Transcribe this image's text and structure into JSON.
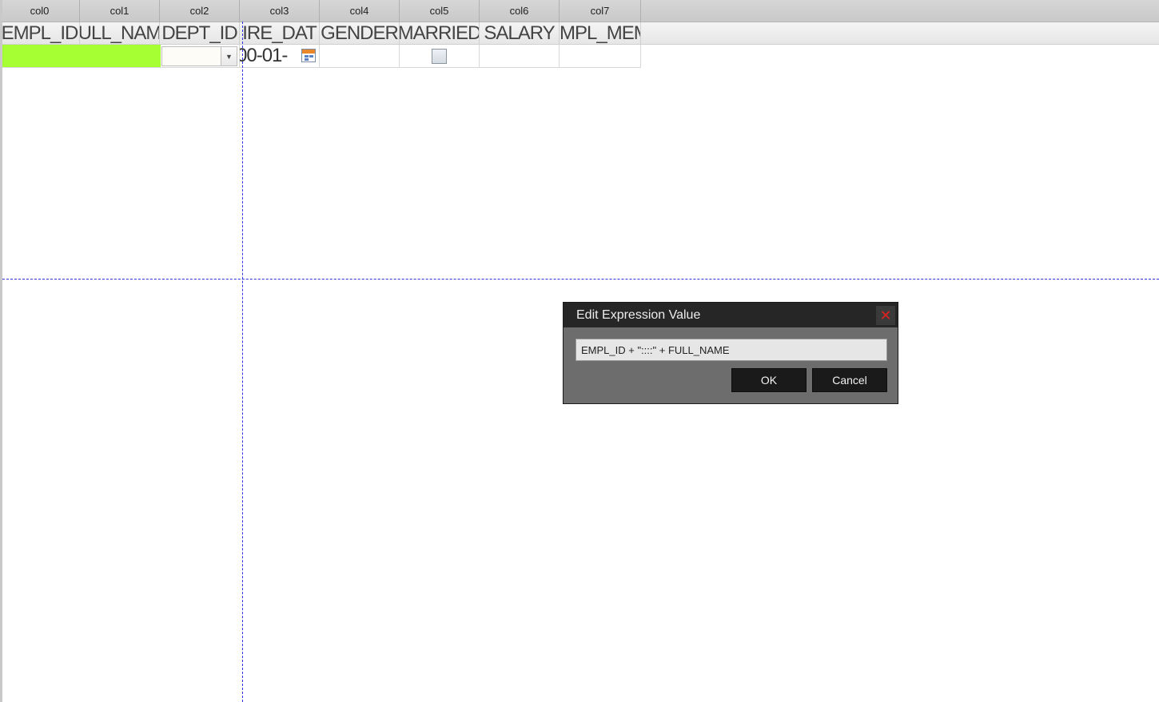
{
  "grid": {
    "column_headers": [
      "col0",
      "col1",
      "col2",
      "col3",
      "col4",
      "col5",
      "col6",
      "col7"
    ],
    "field_headers": [
      "EMPL_ID",
      "ULL_NAM",
      "DEPT_ID",
      "IRE_DAT",
      "GENDER",
      "MARRIED",
      "SALARY",
      "MPL_MEM"
    ],
    "row": {
      "hire_date_partial": "00-01-",
      "highlight_color": "#a6ff33"
    }
  },
  "dialog": {
    "title": "Edit Expression Value",
    "expression": "EMPL_ID + \"::::\" + FULL_NAME",
    "ok_label": "OK",
    "cancel_label": "Cancel",
    "close_glyph": "✕"
  }
}
